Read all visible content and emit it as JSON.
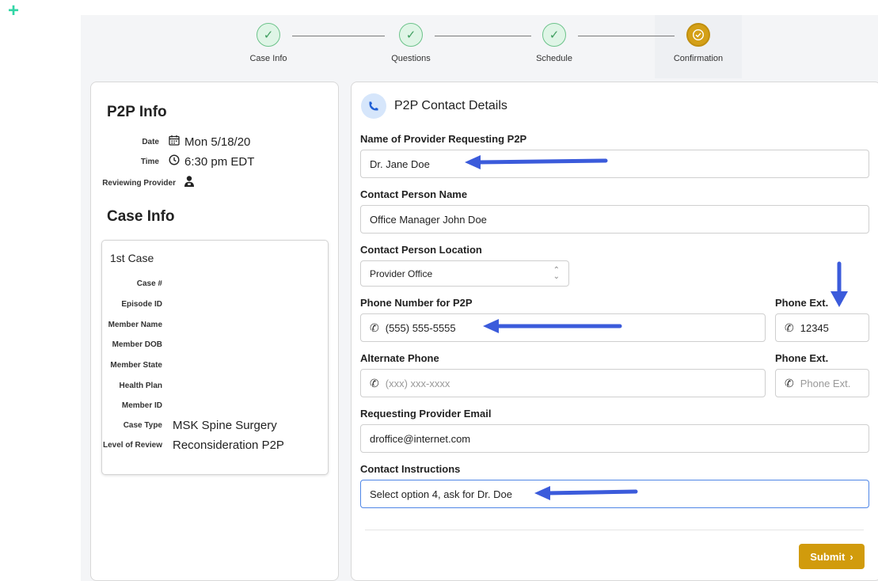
{
  "stepper": {
    "steps": [
      {
        "label": "Case Info",
        "state": "done"
      },
      {
        "label": "Questions",
        "state": "done"
      },
      {
        "label": "Schedule",
        "state": "done"
      },
      {
        "label": "Confirmation",
        "state": "current"
      }
    ]
  },
  "left_panel": {
    "p2p_title": "P2P Info",
    "date_label": "Date",
    "date_value": "Mon 5/18/20",
    "time_label": "Time",
    "time_value": "6:30 pm EDT",
    "reviewer_label": "Reviewing Provider",
    "case_title": "Case Info",
    "case_card": {
      "title": "1st Case",
      "rows": [
        {
          "label": "Case #",
          "value": ""
        },
        {
          "label": "Episode ID",
          "value": ""
        },
        {
          "label": "Member Name",
          "value": ""
        },
        {
          "label": "Member DOB",
          "value": ""
        },
        {
          "label": "Member State",
          "value": ""
        },
        {
          "label": "Health Plan",
          "value": ""
        },
        {
          "label": "Member ID",
          "value": ""
        },
        {
          "label": "Case Type",
          "value": "MSK Spine Surgery"
        },
        {
          "label": "Level of Review",
          "value": "Reconsideration P2P"
        }
      ]
    }
  },
  "right_panel": {
    "title": "P2P Contact Details",
    "provider_name_label": "Name of Provider Requesting P2P",
    "provider_name_value": "Dr. Jane Doe",
    "contact_name_label": "Contact Person Name",
    "contact_name_value": "Office Manager John Doe",
    "contact_location_label": "Contact Person Location",
    "contact_location_value": "Provider Office",
    "phone_label": "Phone Number for P2P",
    "phone_value": "(555) 555-5555",
    "phone_ext_label": "Phone Ext.",
    "phone_ext_value": "12345",
    "alt_phone_label": "Alternate Phone",
    "alt_phone_placeholder": "(xxx) xxx-xxxx",
    "alt_ext_label": "Phone Ext.",
    "alt_ext_placeholder": "Phone Ext.",
    "email_label": "Requesting Provider Email",
    "email_value": "droffice@internet.com",
    "instructions_label": "Contact Instructions",
    "instructions_value": "Select option 4, ask for Dr. Doe",
    "submit_label": "Submit"
  },
  "colors": {
    "accent": "#d19b0c",
    "arrow": "#3b5bdb",
    "done_green": "#6cc38a",
    "focus_blue": "#4f86e6"
  }
}
